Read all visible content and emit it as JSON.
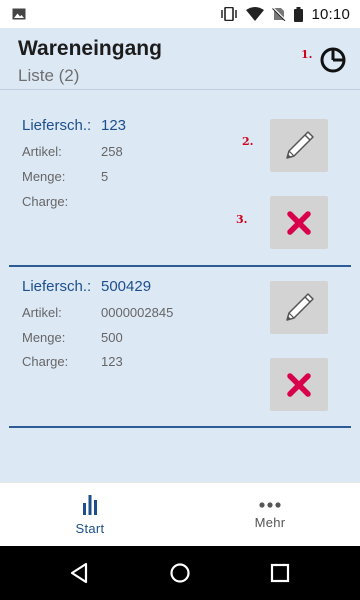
{
  "status_bar": {
    "time": "10:10",
    "icons": [
      "image-icon",
      "vibrate-icon",
      "wifi-icon",
      "no-sim-icon",
      "battery-icon"
    ]
  },
  "header": {
    "title": "Wareneingang",
    "subtitle": "Liste (2)",
    "action_icon": "pie-chart-icon"
  },
  "annotations": [
    "1.",
    "2.",
    "3."
  ],
  "items": [
    {
      "lieferschein_label": "Liefersch.:",
      "lieferschein_value": "123",
      "fields": [
        {
          "label": "Artikel:",
          "value": "258"
        },
        {
          "label": "Menge:",
          "value": "5"
        },
        {
          "label": "Charge:",
          "value": ""
        }
      ],
      "edit_icon": "pencil-icon",
      "delete_icon": "delete-x-icon"
    },
    {
      "lieferschein_label": "Liefersch.:",
      "lieferschein_value": "500429",
      "fields": [
        {
          "label": "Artikel:",
          "value": "0000002845"
        },
        {
          "label": "Menge:",
          "value": "500"
        },
        {
          "label": "Charge:",
          "value": "123"
        }
      ],
      "edit_icon": "pencil-icon",
      "delete_icon": "delete-x-icon"
    }
  ],
  "bottom_nav": [
    {
      "label": "Start",
      "icon": "bar-chart-icon",
      "active": true
    },
    {
      "label": "Mehr",
      "icon": "more-dots-icon",
      "active": false
    }
  ],
  "system_nav": [
    "back-icon",
    "home-icon",
    "recents-icon"
  ],
  "colors": {
    "accent": "#1d4f8c",
    "background": "#dde8f5",
    "delete": "#d8004a",
    "annotation": "#d0021b"
  }
}
